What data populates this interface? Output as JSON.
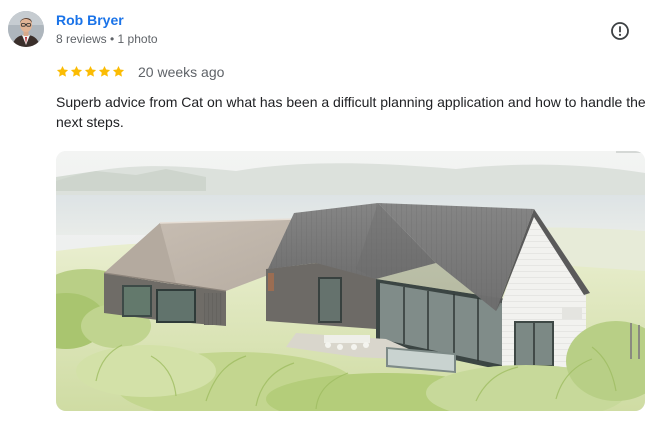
{
  "review": {
    "reviewer": {
      "name": "Rob Bryer",
      "meta": "8 reviews • 1 photo",
      "avatar_icon": "reviewer-avatar"
    },
    "report_icon": "alert-circle-icon",
    "rating": {
      "stars": 5,
      "max": 5,
      "color": "#fbbc04"
    },
    "date": "20 weeks ago",
    "text": "Superb advice from Cat on what has been a difficult planning application and how to handle the next steps.",
    "photo": {
      "subject": "architectural-house-render"
    }
  },
  "colors": {
    "name_link": "#1a73e8",
    "secondary_text": "#5f6368",
    "body_text": "#202124",
    "star": "#fbbc04"
  }
}
